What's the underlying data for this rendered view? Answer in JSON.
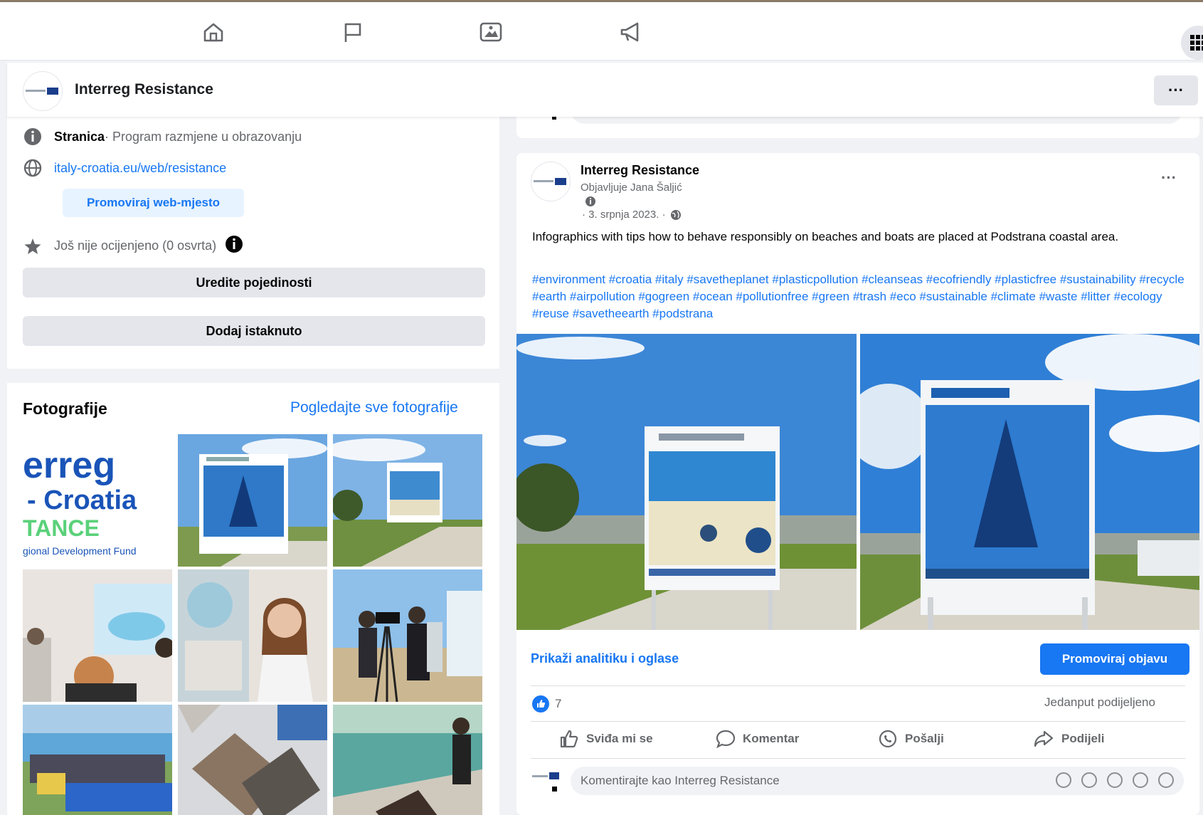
{
  "page": {
    "name": "Interreg Resistance",
    "more": "···"
  },
  "intro": {
    "category_label": "Stranica",
    "category_value": " · Program razmjene u obrazovanju",
    "website": "italy-croatia.eu/web/resistance",
    "promote_website": "Promoviraj web-mjesto",
    "rating": "Još nije ocijenjeno (0 osvrta)",
    "edit_details": "Uredite pojedinosti",
    "add_featured": "Dodaj istaknuto"
  },
  "photos": {
    "title": "Fotografije",
    "see_all": "Pogledajte sve fotografije",
    "logo_text_1": "erreg",
    "logo_text_2": "- Croatia",
    "logo_text_3": "TANCE",
    "logo_text_4": "gional Development Fund"
  },
  "prev_post": {
    "comment_placeholder": "Komentirajte kao Interreg Resistance"
  },
  "post": {
    "author": "Interreg Resistance",
    "published_by": "Objavljuje Jana Šaljić",
    "date": "· 3. srpnja 2023. ·",
    "more": "···",
    "text": "Infographics with tips how to behave responsibly on beaches and boats are placed at Podstrana coastal area.",
    "hashtags": "#environment #croatia #italy #savetheplanet #plasticpollution #cleanseas #ecofriendly #plasticfree #sustainability #recycle #earth #airpollution #gogreen #ocean #pollutionfree #green #trash #eco #sustainable #climate #waste #litter #ecology #reuse #savetheearth #podstrana",
    "analytics": "Prikaži analitiku i oglase",
    "promote": "Promoviraj objavu",
    "reaction_count": "7",
    "shares": "Jedanput podijeljeno",
    "actions": {
      "like": "Sviđa mi se",
      "comment": "Komentar",
      "send": "Pošalji",
      "share": "Podijeli"
    },
    "comment_placeholder": "Komentirajte kao Interreg Resistance"
  },
  "colors": {
    "accent": "#1877f2",
    "background": "#f0f2f5",
    "sky": "#2f7fd6",
    "grass": "#6b8f3a"
  }
}
